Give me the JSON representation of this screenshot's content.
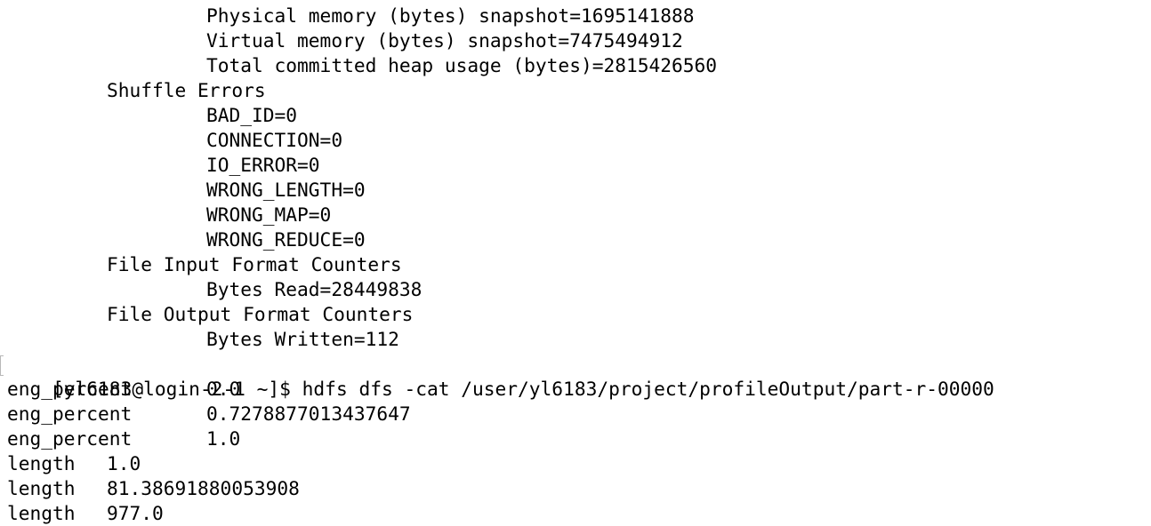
{
  "terminal": {
    "counter_lines": [
      {
        "level": 2,
        "text": "Physical memory (bytes) snapshot=1695141888"
      },
      {
        "level": 2,
        "text": "Virtual memory (bytes) snapshot=7475494912"
      },
      {
        "level": 2,
        "text": "Total committed heap usage (bytes)=2815426560"
      },
      {
        "level": 1,
        "text": "Shuffle Errors"
      },
      {
        "level": 2,
        "text": "BAD_ID=0"
      },
      {
        "level": 2,
        "text": "CONNECTION=0"
      },
      {
        "level": 2,
        "text": "IO_ERROR=0"
      },
      {
        "level": 2,
        "text": "WRONG_LENGTH=0"
      },
      {
        "level": 2,
        "text": "WRONG_MAP=0"
      },
      {
        "level": 2,
        "text": "WRONG_REDUCE=0"
      },
      {
        "level": 1,
        "text": "File Input Format Counters"
      },
      {
        "level": 2,
        "text": "Bytes Read=28449838"
      },
      {
        "level": 1,
        "text": "File Output Format Counters"
      },
      {
        "level": 2,
        "text": "Bytes Written=112"
      }
    ],
    "prompt": {
      "text": "[yl6183@login-2-1 ~]$ ",
      "command": "hdfs dfs -cat /user/yl6183/project/profileOutput/part-r-00000"
    },
    "output_rows": [
      {
        "key": "eng_percent",
        "value": "0.0"
      },
      {
        "key": "eng_percent",
        "value": "0.7278877013437647"
      },
      {
        "key": "eng_percent",
        "value": "1.0"
      },
      {
        "key": "length",
        "value": "1.0"
      },
      {
        "key": "length",
        "value": "81.38691880053908"
      },
      {
        "key": "length",
        "value": "977.0"
      }
    ]
  },
  "colors": {
    "background": "#ffffff",
    "text": "#000000",
    "bracket_mark": "#b8b8b8"
  }
}
